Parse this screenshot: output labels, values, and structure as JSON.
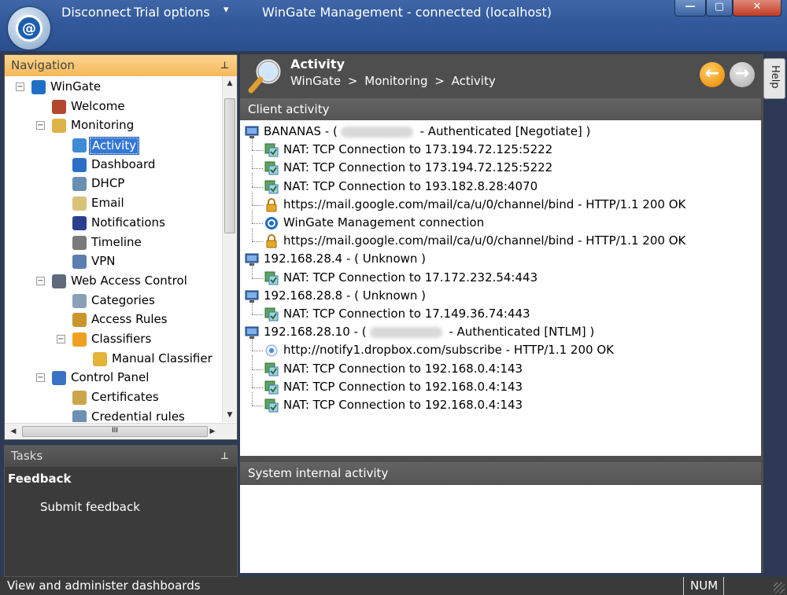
{
  "titlebar": {
    "quick_access": {
      "disconnect": "Disconnect",
      "trial": "Trial options",
      "dropdown": "▾"
    },
    "window_title": "WinGate Management - connected (localhost)",
    "buttons": {
      "minimize": "—",
      "maximize": "▢",
      "close": "✕"
    }
  },
  "navigation": {
    "header": "Navigation",
    "pin": "⊥",
    "tree": [
      {
        "label": "WinGate",
        "level": 0,
        "expander": "−",
        "icon": "wingate-icon",
        "color": "#1f6fc5"
      },
      {
        "label": "Welcome",
        "level": 1,
        "expander": "",
        "icon": "welcome-icon",
        "color": "#b4472d"
      },
      {
        "label": "Monitoring",
        "level": 1,
        "expander": "−",
        "icon": "monitoring-folder-icon",
        "color": "#e0b24a"
      },
      {
        "label": "Activity",
        "level": 2,
        "expander": "",
        "icon": "activity-icon",
        "color": "#3e8bd6",
        "selected": true
      },
      {
        "label": "Dashboard",
        "level": 2,
        "expander": "",
        "icon": "dashboard-icon",
        "color": "#2d6ec9"
      },
      {
        "label": "DHCP",
        "level": 2,
        "expander": "",
        "icon": "dhcp-icon",
        "color": "#6b8fb3"
      },
      {
        "label": "Email",
        "level": 2,
        "expander": "",
        "icon": "email-icon",
        "color": "#d9c27a"
      },
      {
        "label": "Notifications",
        "level": 2,
        "expander": "",
        "icon": "notifications-icon",
        "color": "#2a3f8f"
      },
      {
        "label": "Timeline",
        "level": 2,
        "expander": "",
        "icon": "timeline-icon",
        "color": "#7a7a7a"
      },
      {
        "label": "VPN",
        "level": 2,
        "expander": "",
        "icon": "vpn-icon",
        "color": "#5a7fb0"
      },
      {
        "label": "Web Access Control",
        "level": 1,
        "expander": "−",
        "icon": "web-access-control-icon",
        "color": "#5f6b7a"
      },
      {
        "label": "Categories",
        "level": 2,
        "expander": "",
        "icon": "categories-icon",
        "color": "#8aa0b8"
      },
      {
        "label": "Access Rules",
        "level": 2,
        "expander": "",
        "icon": "access-rules-icon",
        "color": "#c9962b"
      },
      {
        "label": "Classifiers",
        "level": 2,
        "expander": "−",
        "icon": "classifiers-icon",
        "color": "#f0a020"
      },
      {
        "label": "Manual Classifier",
        "level": 3,
        "expander": "",
        "icon": "manual-classifier-icon",
        "color": "#e2b43a"
      },
      {
        "label": "Control Panel",
        "level": 1,
        "expander": "−",
        "icon": "control-panel-icon",
        "color": "#3a73c4"
      },
      {
        "label": "Certificates",
        "level": 2,
        "expander": "",
        "icon": "certificates-icon",
        "color": "#c9a64a"
      },
      {
        "label": "Credential rules",
        "level": 2,
        "expander": "",
        "icon": "credential-rules-icon",
        "color": "#6f8fb5"
      }
    ],
    "hscroll_grip": "III"
  },
  "tasks": {
    "header": "Tasks",
    "pin": "⊥",
    "heading": "Feedback",
    "items": [
      "Submit feedback"
    ]
  },
  "content": {
    "title": "Activity",
    "breadcrumb": [
      "WinGate",
      ">",
      "Monitoring",
      ">",
      "Activity"
    ],
    "back": "←",
    "forward": "→",
    "client_activity_header": "Client activity",
    "system_activity_header": "System internal activity",
    "client_activity": [
      {
        "level": 0,
        "icon": "computer-icon",
        "before": "BANANAS  -  (",
        "blurred": true,
        "after": " -  Authenticated [Negotiate] )"
      },
      {
        "level": 1,
        "icon": "nat-icon",
        "text": "NAT: TCP Connection to 173.194.72.125:5222"
      },
      {
        "level": 1,
        "icon": "nat-icon",
        "text": "NAT: TCP Connection to 173.194.72.125:5222"
      },
      {
        "level": 1,
        "icon": "nat-icon",
        "text": "NAT: TCP Connection to 193.182.8.28:4070"
      },
      {
        "level": 1,
        "icon": "lock-icon",
        "text": "https://mail.google.com/mail/ca/u/0/channel/bind - HTTP/1.1 200 OK"
      },
      {
        "level": 1,
        "icon": "wingate-connection-icon",
        "text": "WinGate Management connection"
      },
      {
        "level": 1,
        "icon": "lock-icon",
        "text": "https://mail.google.com/mail/ca/u/0/channel/bind - HTTP/1.1 200 OK"
      },
      {
        "level": 0,
        "icon": "computer-icon",
        "text": "192.168.28.4  -  ( Unknown )"
      },
      {
        "level": 1,
        "icon": "nat-icon",
        "text": "NAT: TCP Connection to 17.172.232.54:443"
      },
      {
        "level": 0,
        "icon": "computer-icon",
        "text": "192.168.28.8  -  ( Unknown )"
      },
      {
        "level": 1,
        "icon": "nat-icon",
        "text": "NAT: TCP Connection to 17.149.36.74:443"
      },
      {
        "level": 0,
        "icon": "computer-icon",
        "before": "192.168.28.10  -  (",
        "blurred": true,
        "after": " -  Authenticated [NTLM] )"
      },
      {
        "level": 1,
        "icon": "globe-icon",
        "text": "http://notify1.dropbox.com/subscribe - HTTP/1.1 200 OK"
      },
      {
        "level": 1,
        "icon": "nat-icon",
        "text": "NAT: TCP Connection to 192.168.0.4:143"
      },
      {
        "level": 1,
        "icon": "nat-icon",
        "text": "NAT: TCP Connection to 192.168.0.4:143"
      },
      {
        "level": 1,
        "icon": "nat-icon",
        "text": "NAT: TCP Connection to 192.168.0.4:143"
      }
    ],
    "help_tab": "Help"
  },
  "statusbar": {
    "text": "View and administer dashboards",
    "num": "NUM"
  }
}
